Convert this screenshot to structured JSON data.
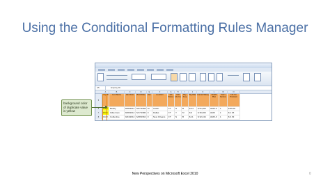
{
  "slide": {
    "title": "Using the Conditional Formatting Rules Manager",
    "footer": "New Perspectives on Microsoft Excel 2010",
    "page_number": "0"
  },
  "excel": {
    "name_box": "A5",
    "formula": "Employ ID",
    "col_headers": [
      "A",
      "B",
      "C",
      "D",
      "E",
      "F",
      "G",
      "H",
      "I",
      "J",
      "K",
      "L",
      "M",
      "N"
    ],
    "header_cells": [
      "Emp ID",
      "Last Name",
      "Hire Date",
      "Birth Date",
      "Sex",
      "Location",
      "Job Status",
      "Add Life Ins",
      "Pay Freq",
      "Pay Rate",
      "Annual Salary",
      "Health Plan",
      "Years Service",
      "Life Ins Premium"
    ],
    "rows": [
      {
        "row_num": "6",
        "cells": [
          "1025",
          "Beatty",
          "8/28/2011",
          "5/27/1968",
          "M",
          "Austin",
          "FT",
          "N",
          "B",
          "$ 24",
          "$ 51,000",
          "HMO-F",
          "1",
          "$ 85.00"
        ]
      },
      {
        "row_num": "7",
        "cells": [
          "1025",
          "Gilkerman",
          "8/28/2012",
          "5/17/1986",
          "F",
          "Dallas",
          "FT",
          "Y",
          "M",
          "$ 9",
          "$ 36,000",
          "HMO",
          "1",
          "$ 1.06"
        ]
      },
      {
        "row_num": "8",
        "cells": [
          "1028",
          "Colbertine",
          "9/24/2012",
          "6/28/1962",
          "F",
          "New Orleans",
          "FT",
          "N",
          "B",
          "$ 11",
          "$ 32,244",
          "HMO-F",
          "1",
          "$ 3.63"
        ]
      }
    ],
    "header_row_num": "5"
  },
  "callout": {
    "text": "background color of duplicate value is yellow"
  },
  "colors": {
    "title": "#4a6fa5",
    "header_fill": "#f3a95c",
    "duplicate_fill": "#ffff00",
    "callout_fill": "#dde9cf"
  }
}
